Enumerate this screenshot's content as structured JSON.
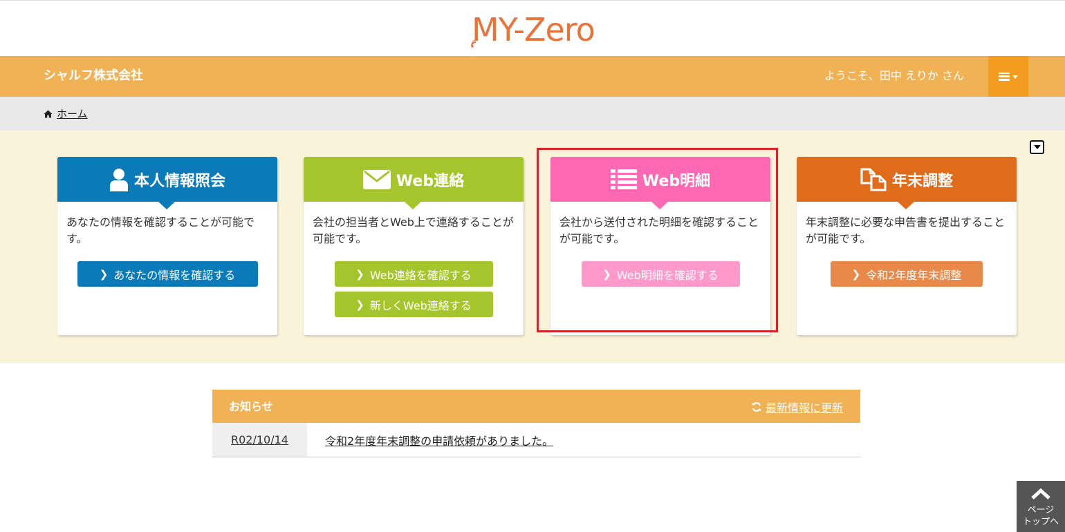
{
  "logo": {
    "text": "MY-Zero",
    "color": "#e8743b"
  },
  "header": {
    "company": "シャルフ株式会社",
    "welcome": "ようこそ、田中 えりか さん",
    "menu_icon": "hamburger-icon"
  },
  "breadcrumb": {
    "home_icon": "home-icon",
    "home_label": "ホーム"
  },
  "cards": [
    {
      "title": "本人情報照会",
      "icon": "user-icon",
      "color": "#0a7bb8",
      "description": "あなたの情報を確認することが可能です。",
      "buttons": [
        "あなたの情報を確認する"
      ]
    },
    {
      "title": "Web連絡",
      "icon": "envelope-icon",
      "color": "#a4c52c",
      "description": "会社の担当者とWeb上で連絡することが可能です。",
      "buttons": [
        "Web連絡を確認する",
        "新しくWeb連絡する"
      ]
    },
    {
      "title": "Web明細",
      "icon": "list-icon",
      "color": "#ff69b4",
      "description": "会社から送付された明細を確認することが可能です。",
      "buttons": [
        "Web明細を確認する"
      ]
    },
    {
      "title": "年末調整",
      "icon": "documents-icon",
      "color": "#e06c1b",
      "description": "年末調整に必要な申告書を提出することが可能です。",
      "buttons": [
        "令和2年度年末調整"
      ]
    }
  ],
  "news": {
    "title": "お知らせ",
    "refresh_label": "最新情報に更新",
    "refresh_icon": "refresh-icon",
    "items": [
      {
        "date": "R02/10/14",
        "text": "令和2年度年末調整の申請依頼がありました。"
      }
    ]
  },
  "page_top": {
    "label_line1": "ページ",
    "label_line2": "トップへ",
    "icon": "chevron-up-icon"
  },
  "highlight_color": "#d9232a"
}
